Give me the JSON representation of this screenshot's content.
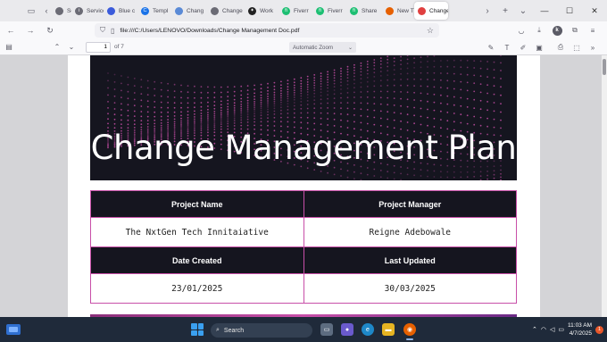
{
  "browser": {
    "tabs": [
      {
        "label": "Servic",
        "color": "#6b6b75",
        "icon": "web-icon",
        "glyph": ""
      },
      {
        "label": "Service",
        "color": "#6b6b75",
        "icon": "info-icon",
        "glyph": "i"
      },
      {
        "label": "Blue c",
        "color": "#3b5bdb",
        "icon": "car-icon",
        "glyph": ""
      },
      {
        "label": "Templ",
        "color": "#1a73e8",
        "icon": "canva-icon",
        "glyph": "C"
      },
      {
        "label": "Chang",
        "color": "#5a8ad6",
        "icon": "image-icon",
        "glyph": ""
      },
      {
        "label": "Change M",
        "color": "#6b6b75",
        "icon": "document-icon",
        "glyph": ""
      },
      {
        "label": "Work",
        "color": "#222",
        "icon": "compass-icon",
        "glyph": "✦"
      },
      {
        "label": "Fiverr",
        "color": "#1dbf73",
        "icon": "fiverr-icon",
        "glyph": "fi"
      },
      {
        "label": "Fiverr",
        "color": "#1dbf73",
        "icon": "fiverr-icon",
        "glyph": "fi"
      },
      {
        "label": "Share",
        "color": "#1dbf73",
        "icon": "fiverr-icon",
        "glyph": "fi"
      },
      {
        "label": "New T",
        "color": "#e66000",
        "icon": "firefox-icon",
        "glyph": ""
      },
      {
        "label": "Change",
        "color": "#e04040",
        "icon": "pdf-icon",
        "glyph": "",
        "active": true
      }
    ],
    "url": "file:///C:/Users/LENOVO/Downloads/Change Management Doc.pdf"
  },
  "pdf_toolbar": {
    "page_number": "1",
    "page_count": "of 7",
    "zoom": "Automatic Zoom"
  },
  "document": {
    "title": "Change Management Plan",
    "table": {
      "headers_row1": [
        "Project Name",
        "Project Manager"
      ],
      "values_row1": [
        "The NxtGen Tech Innitaiative",
        "Reigne Adebowale"
      ],
      "headers_row2": [
        "Date Created",
        "Last Updated"
      ],
      "values_row2": [
        "23/01/2025",
        "30/03/2025"
      ]
    }
  },
  "taskbar": {
    "search_label": "Search",
    "time": "11:03 AM",
    "date": "4/7/2025",
    "notifications": "1"
  },
  "colors": {
    "banner_bg": "#15151f",
    "accent_magenta": "#c84fa8",
    "taskbar_bg": "#1f2a3a"
  }
}
